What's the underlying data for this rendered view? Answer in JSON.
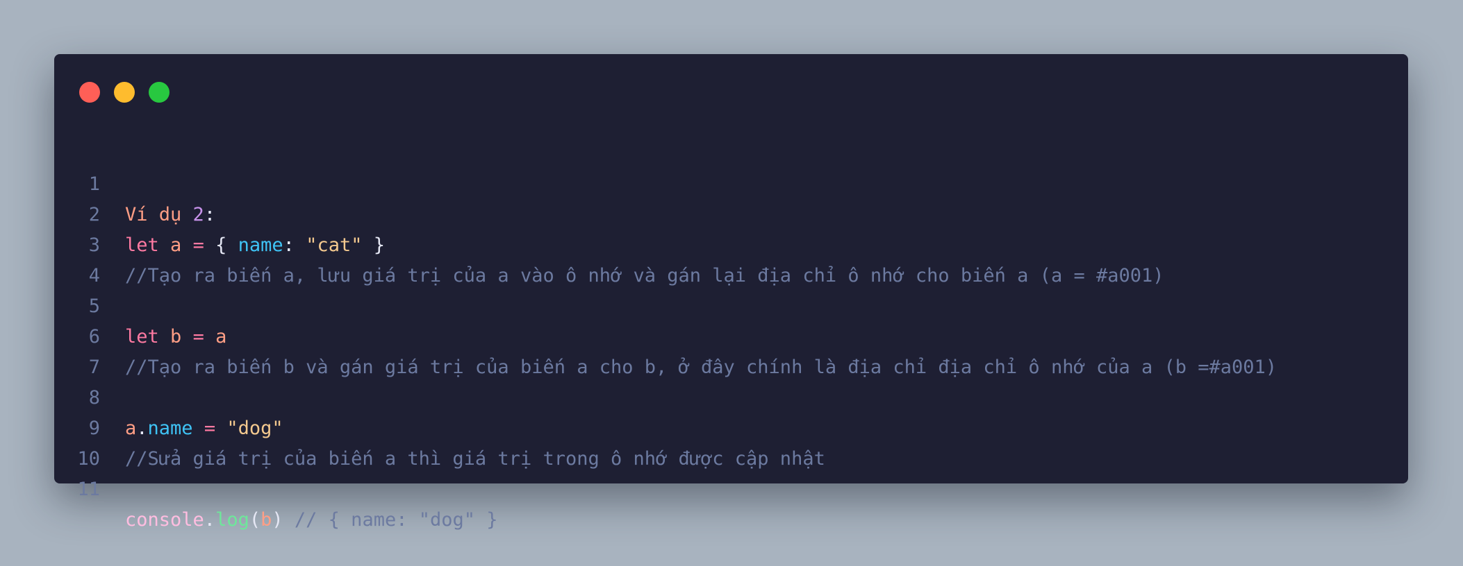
{
  "window": {
    "buttons": [
      "close",
      "minimize",
      "maximize"
    ]
  },
  "colors": {
    "background": "#a8b3bf",
    "window": "#1e1f33",
    "keyword": "#ff7aa2",
    "identifier": "#ff9e85",
    "property": "#3fc3f5",
    "string": "#f4c98f",
    "number": "#c792ea",
    "comment": "#6c7aa0",
    "function": "#6ee79a"
  },
  "code": {
    "line_numbers": [
      "1",
      "2",
      "3",
      "4",
      "5",
      "6",
      "7",
      "8",
      "9",
      "10",
      "11"
    ],
    "l1": {
      "vi_du": "Ví dụ",
      "num": "2",
      "colon": ":"
    },
    "l2": {
      "kw": "let",
      "id": "a",
      "eq": "=",
      "ob": "{",
      "prop": "name",
      "colon": ":",
      "str": "\"cat\"",
      "cb": "}"
    },
    "l3": {
      "comment": "//Tạo ra biến a, lưu giá trị của a vào ô nhớ và gán lại địa chỉ ô nhớ cho biến a (a = #a001)"
    },
    "l5": {
      "kw": "let",
      "id": "b",
      "eq": "=",
      "val": "a"
    },
    "l6": {
      "comment": "//Tạo ra biến b và gán giá trị của biến a cho b, ở đây chính là địa chỉ địa chỉ ô nhớ của a (b =#a001)"
    },
    "l8": {
      "obj": "a",
      "dot": ".",
      "prop": "name",
      "eq": "=",
      "str": "\"dog\""
    },
    "l9": {
      "comment": "//Sửa giá trị của biến a thì giá trị trong ô nhớ được cập nhật"
    },
    "l11": {
      "obj": "console",
      "dot": ".",
      "fn": "log",
      "op": "(",
      "arg": "b",
      "cp": ")",
      "comment": "// { name: \"dog\" }"
    }
  }
}
